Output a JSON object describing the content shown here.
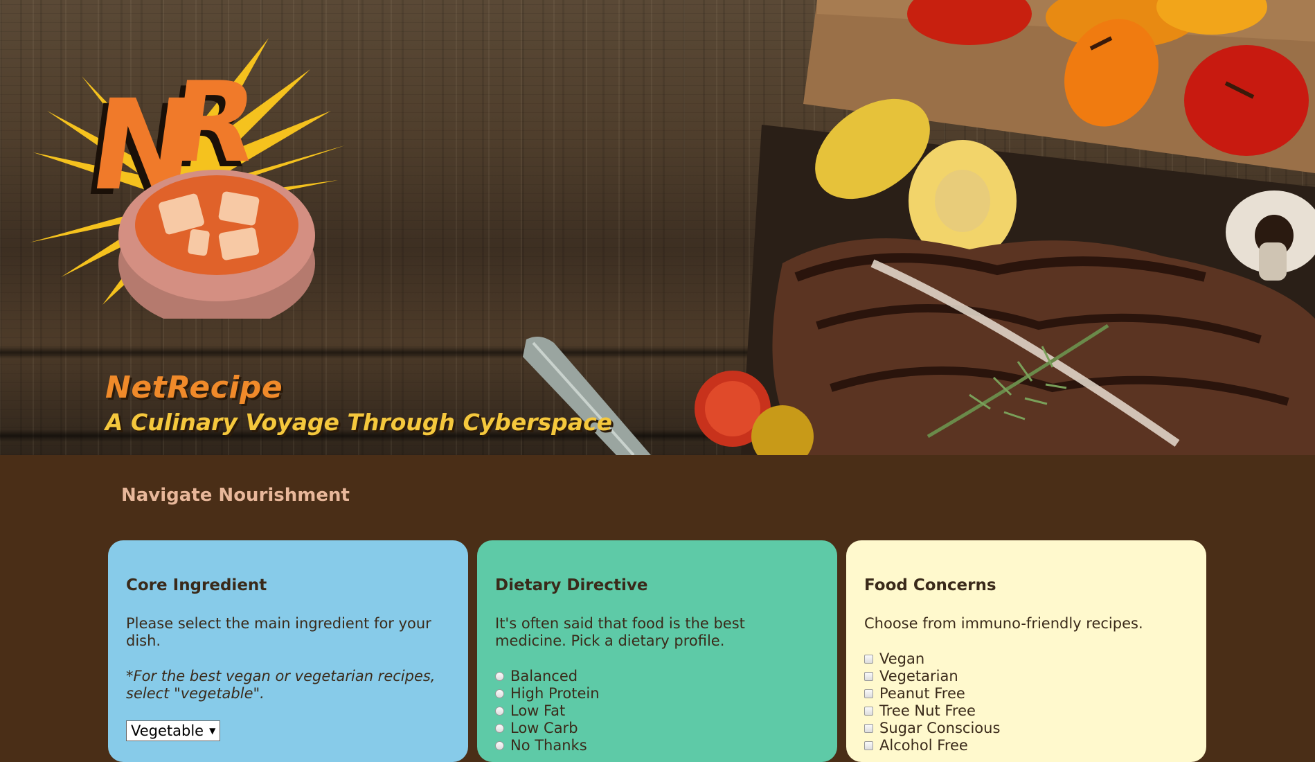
{
  "header": {
    "logo_icon": "nr-soup-bowl-logo",
    "logo_text": "NR",
    "title": "NetRecipe",
    "tagline": "A Culinary Voyage Through Cyberspace"
  },
  "nav": {
    "heading": "Navigate Nourishment"
  },
  "cards": {
    "ingredient": {
      "title": "Core Ingredient",
      "description": "Please select the main ingredient for your dish.",
      "note": "*For the best vegan or vegetarian recipes, select \"vegetable\".",
      "select_value": "Vegetable"
    },
    "diet": {
      "title": "Dietary Directive",
      "description": "It's often said that food is the best medicine. Pick a dietary profile.",
      "options": [
        "Balanced",
        "High Protein",
        "Low Fat",
        "Low Carb",
        "No Thanks"
      ]
    },
    "concerns": {
      "title": "Food Concerns",
      "description": "Choose from immuno-friendly recipes.",
      "options": [
        "Vegan",
        "Vegetarian",
        "Peanut Free",
        "Tree Nut Free",
        "Sugar Conscious",
        "Alcohol Free"
      ]
    }
  },
  "colors": {
    "page_background": "#4a2e17",
    "card_ingredient": "#87cbe9",
    "card_diet": "#5ecaa7",
    "card_concerns": "#fff9cd",
    "title_orange": "#f08a2a",
    "tagline_yellow": "#f5c83d",
    "heading_peach": "#e8b79a"
  }
}
